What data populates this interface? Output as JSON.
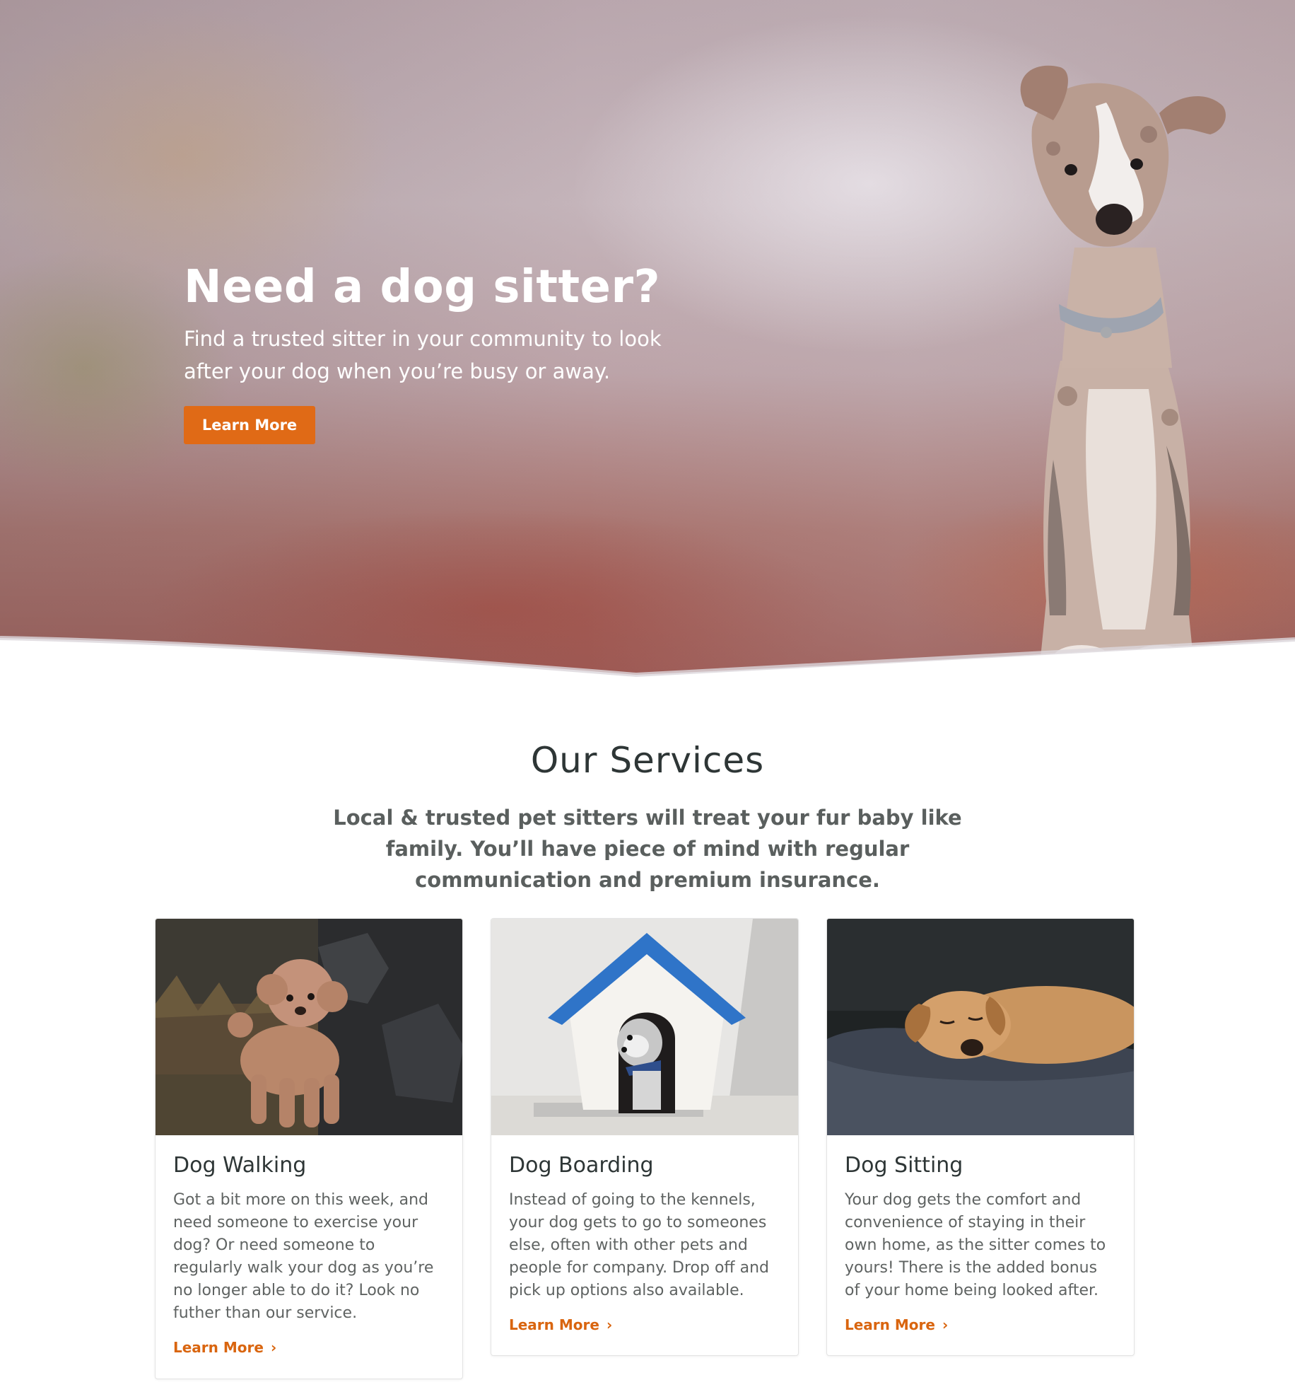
{
  "hero": {
    "title": "Need a dog sitter?",
    "subtitle": "Find a trusted sitter in your community to look after your dog when you’re busy or away.",
    "button_label": "Learn More"
  },
  "services": {
    "title": "Our Services",
    "description": "Local & trusted pet sitters will treat your fur baby like family. You’ll have piece of mind with regular communication and premium insurance.",
    "cards": [
      {
        "title": "Dog Walking",
        "text": "Got a bit more on this week, and need someone to exercise your dog? Or need someone to regularly walk your dog as you’re no longer able to do it? Look no futher than our service.",
        "link_label": "Learn More",
        "image_icon": "poodle-photo"
      },
      {
        "title": "Dog Boarding",
        "text": "Instead of going to the kennels, your dog gets to go to someones else, often with other pets and people for company. Drop off and pick up options also available.",
        "link_label": "Learn More",
        "image_icon": "dog-house-photo"
      },
      {
        "title": "Dog Sitting",
        "text": "Your dog gets the comfort and convenience of staying in their own home, as the sitter comes to yours! There is the added bonus of your home being looked after.",
        "link_label": "Learn More",
        "image_icon": "sleeping-dog-photo"
      }
    ]
  },
  "colors": {
    "accent": "#e06a16",
    "link": "#d9650f",
    "heading": "#2e3636",
    "body_text": "#5f6362"
  },
  "icons": {
    "link_chevron": "›"
  }
}
